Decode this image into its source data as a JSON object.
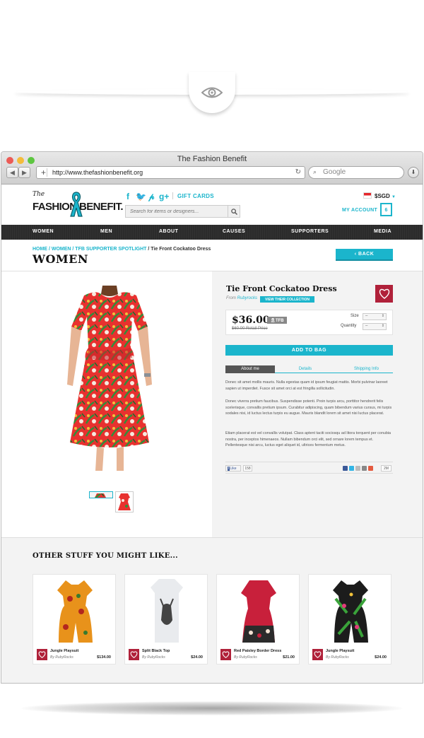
{
  "window": {
    "title": "The Fashion Benefit",
    "url": "http://www.thefashionbenefit.org",
    "search_placeholder": "Google"
  },
  "header": {
    "logo_the": "The",
    "logo_text": "FASHION BENEFIT.",
    "gift_cards": "GIFT CARDS",
    "search_placeholder": "Search for items or designers...",
    "currency": "$SGD",
    "my_account": "MY ACCOUNT",
    "bag_count": "6",
    "social_icons": [
      "facebook-icon",
      "twitter-icon",
      "pinterest-icon",
      "google-plus-icon"
    ]
  },
  "nav": [
    "WOMEN",
    "MEN",
    "ABOUT",
    "CAUSES",
    "SUPPORTERS",
    "MEDIA"
  ],
  "breadcrumb": {
    "links": [
      "HOME",
      "WOMEN",
      "TFB SUPPORTER SPOTLIGHT"
    ],
    "sep": " / ",
    "current": "Tie Front Cockatoo Dress"
  },
  "page_title": "WOMEN",
  "back_label": "‹ BACK",
  "product": {
    "title": "Tie Front Cockatoo Dress",
    "from_label": "From",
    "brand": "Rubyrocks",
    "view_collection": "VIEW THEIR COLLECTION",
    "price": "$36.00",
    "tfb_badge": "TFB",
    "retail": "$60.00 Retail Price",
    "size_label": "Size",
    "size_value": "–",
    "quantity_label": "Quantity",
    "quantity_value": "–",
    "add_to_bag": "ADD TO BAG",
    "tabs": [
      "About me",
      "Details",
      "Shipping Info"
    ],
    "paragraphs": [
      "Donec sit amet mollis mauris. Nulla egestas quam id ipsum feugiat mattis. Morbi pulvinar laoreet sapien ut imperdiet. Fusce sit amet orci at est fringilla sollicitudin.",
      "Donec viverra pretium faucibus. Suspendisse potenti. Proin turpis arcu, porttitor hendrerit felis scelerisque, convallis pretium ipsum. Curabitur adipiscing, quam bibendum varius cursus, mi turpis sodales nisi, id luctus lectus turpis eu augue. Mauris blandit lorem sit amet nisi luctus placerat.",
      "Etiam placerat est vel convallis volutpat. Class aptent taciti sociosqu ad litora torquent per conubia nostra, per inceptos himenaeos. Nullam bibendum orci elit, sed ornare lorem tempus et. Pellentesque nisi arcu, luctus eget aliquet id, ultrices fermentum metus."
    ],
    "like_label": "Like",
    "like_count": "158",
    "share_count": "2M"
  },
  "related": {
    "heading": "OTHER STUFF YOU MIGHT LIKE...",
    "items": [
      {
        "name": "Jungle Playsuit",
        "by": "By RubyRocks",
        "price": "$134.00"
      },
      {
        "name": "Split Black Top",
        "by": "By RubyRocks",
        "price": "$24.00"
      },
      {
        "name": "Red Paisley Border Dress",
        "by": "By RubyRocks",
        "price": "$21.00"
      },
      {
        "name": "Jungle Playsuit",
        "by": "By RubyRocks",
        "price": "$24.00"
      }
    ]
  },
  "colors": {
    "accent": "#1bb5cc",
    "nav_bg": "#2b2b2b",
    "brand_red": "#b0213a"
  }
}
